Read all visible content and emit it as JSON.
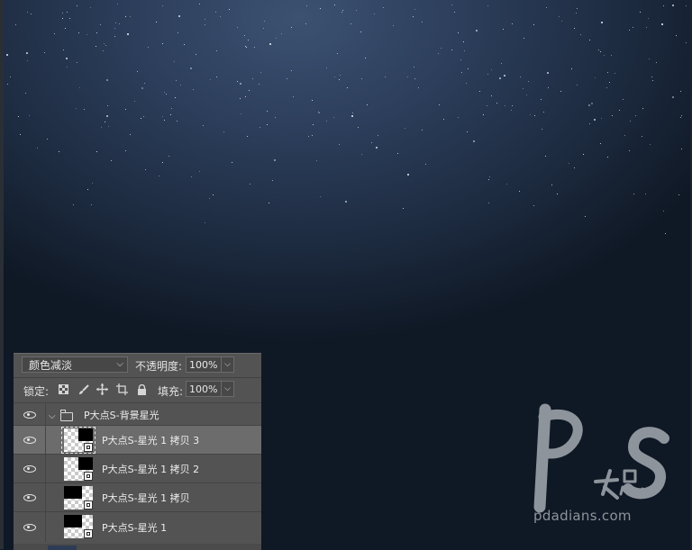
{
  "canvas": {
    "description_colors": {
      "top": "#3c5171",
      "bottom": "#0f1825"
    }
  },
  "layers_panel": {
    "blend_mode": "颜色减淡",
    "opacity_label": "不透明度:",
    "opacity_value": "100%",
    "lock_label": "锁定:",
    "fill_label": "填充:",
    "fill_value": "100%",
    "group": {
      "name": "P大点S-背景星光"
    },
    "layers": [
      {
        "name": "P大点S-星光 1 拷贝 3",
        "selected": true
      },
      {
        "name": "P大点S-星光 1 拷贝 2",
        "selected": false
      },
      {
        "name": "P大点S-星光 1 拷贝",
        "selected": false
      },
      {
        "name": "P大点S-星光 1",
        "selected": false
      }
    ]
  },
  "watermark": {
    "url": "pdadians.com"
  },
  "icons": [
    "eye-icon",
    "folder-icon",
    "lock-transparent-icon",
    "lock-brush-icon",
    "lock-move-icon",
    "lock-artboard-icon",
    "lock-all-icon",
    "chevron-down-icon"
  ]
}
